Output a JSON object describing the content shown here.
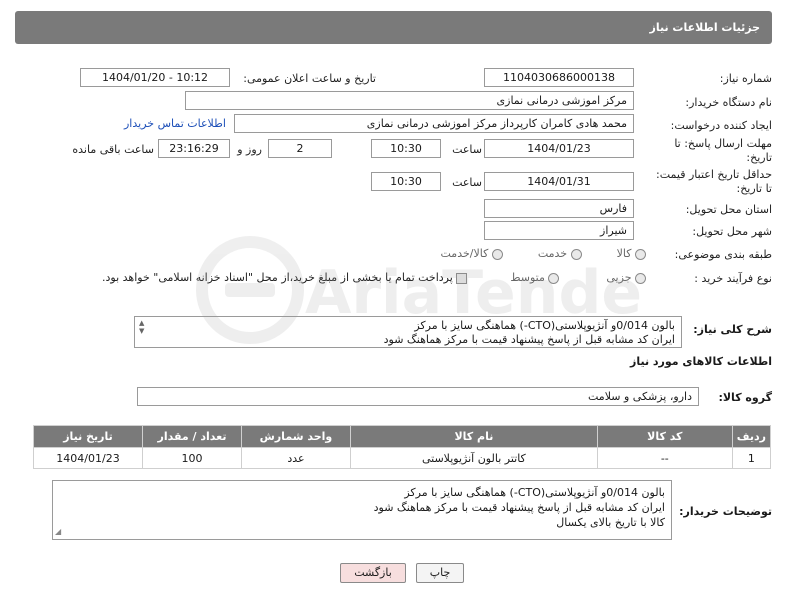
{
  "header": {
    "title": "جزئیات اطلاعات نیاز"
  },
  "fields": {
    "need_number_label": "شماره نیاز:",
    "need_number": "1104030686000138",
    "announce_label": "تاریخ و ساعت اعلان عمومی:",
    "announce_value": "1404/01/20 - 10:12",
    "buyer_org_label": "نام دستگاه خریدار:",
    "buyer_org": "مرکز اموزشی درمانی نمازی",
    "creator_label": "ایجاد کننده درخواست:",
    "creator": "محمد هادی کامران کارپرداز مرکز اموزشی درمانی نمازی",
    "contact_link": "اطلاعات تماس خریدار",
    "reply_deadline_label_1": "مهلت ارسال پاسخ: تا",
    "reply_deadline_label_2": "تاریخ:",
    "reply_date": "1404/01/23",
    "time_label": "ساعت",
    "reply_time": "10:30",
    "days_value": "2",
    "days_label": "روز و",
    "remaining_time": "23:16:29",
    "remaining_label": "ساعت باقی مانده",
    "price_validity_label_1": "حداقل تاریخ اعتبار قیمت:",
    "price_validity_label_2": "تا تاریخ:",
    "price_date": "1404/01/31",
    "price_time": "10:30",
    "province_label": "استان محل تحویل:",
    "province": "فارس",
    "city_label": "شهر محل تحویل:",
    "city": "شیراز",
    "category_label": "طبقه بندی موضوعی:",
    "category_options": [
      "کالا",
      "خدمت",
      "کالا/خدمت"
    ],
    "process_label": "نوع فرآیند خرید :",
    "process_options": [
      "جزیی",
      "متوسط"
    ],
    "payment_note": "پرداخت تمام یا بخشی از مبلغ خرید،از محل \"اسناد خزانه اسلامی\" خواهد بود."
  },
  "summary": {
    "label": "شرح کلی نیاز:",
    "line1": "بالون 0/014و  آنژیوپلاستی(CTO-) هماهنگی سایز با مرکز",
    "line2": "ایران کد مشابه قبل از پاسخ پیشنهاد قیمت با مرکز هماهنگ شود"
  },
  "goods": {
    "section_title": "اطلاعات کالاهای مورد نیاز",
    "group_label": "گروه کالا:",
    "group_value": "دارو، پزشکی و سلامت",
    "columns": [
      "ردیف",
      "کد کالا",
      "نام کالا",
      "واحد شمارش",
      "تعداد / مقدار",
      "تاریخ نیاز"
    ],
    "rows": [
      [
        "1",
        "--",
        "کاتتر بالون آنژیوپلاستی",
        "عدد",
        "100",
        "1404/01/23"
      ]
    ]
  },
  "buyer_notes": {
    "label": "توضیحات خریدار:",
    "line1": "بالون 0/014و  آنژیوپلاستی(CTO-) هماهنگی سایز با مرکز",
    "line2": "ایران کد مشابه قبل از پاسخ پیشنهاد قیمت با مرکز هماهنگ شود",
    "line3": "کالا با تاریخ بالای یکسال"
  },
  "buttons": {
    "print": "چاپ",
    "back": "بازگشت"
  },
  "watermark": {
    "text": "AriaTender.neT"
  },
  "colors": {
    "header_bg": "#7a7a7a",
    "link": "#1d4fb8",
    "back_button_bg": "#f7dede"
  }
}
